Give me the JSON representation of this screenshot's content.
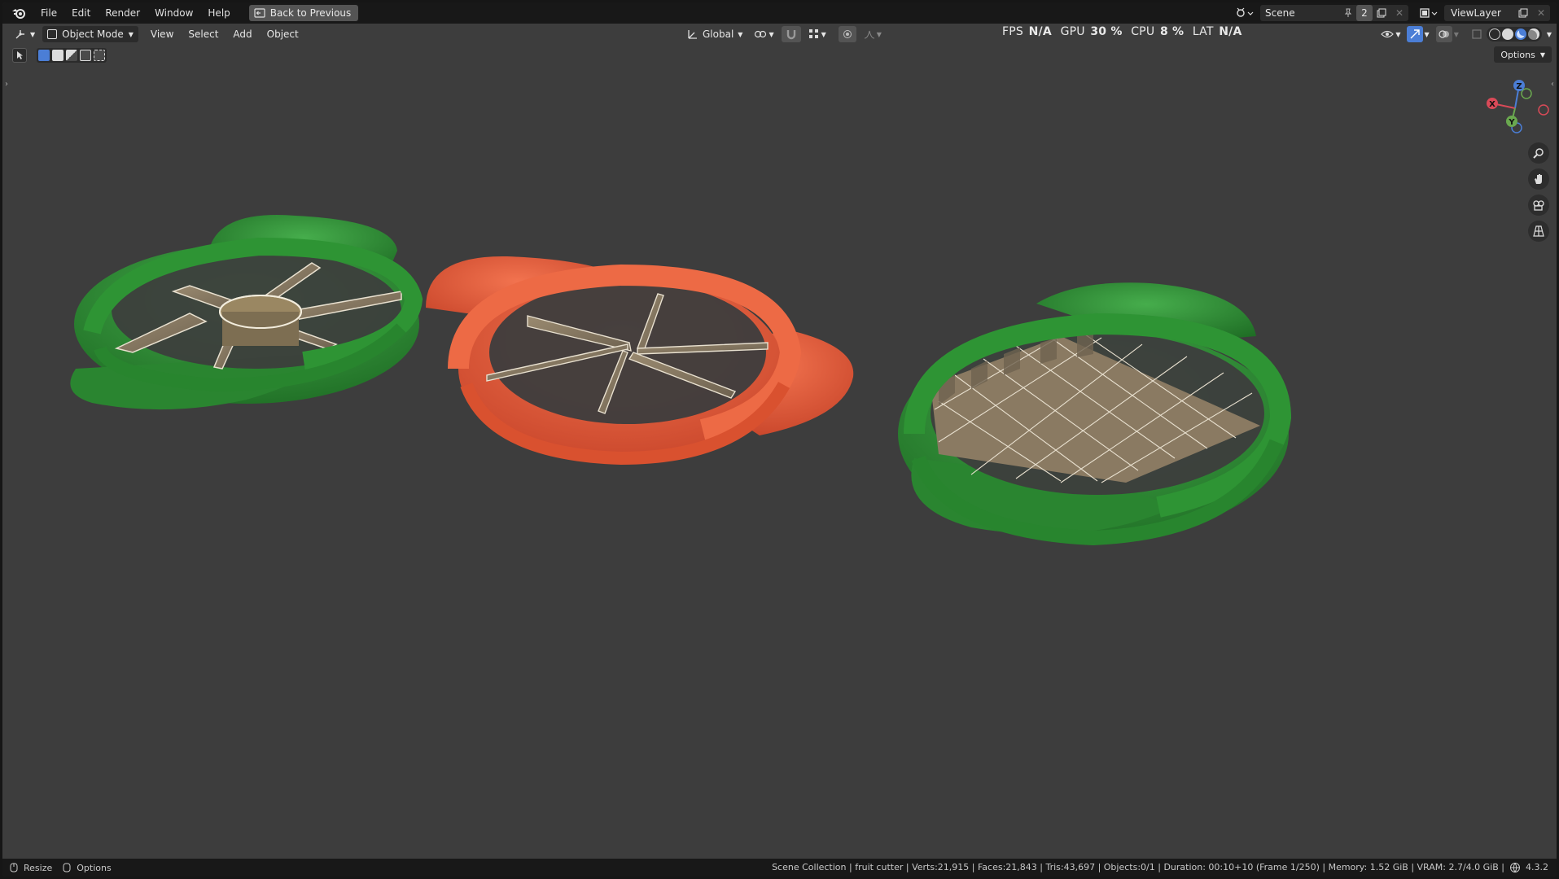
{
  "menu": {
    "items": [
      "File",
      "Edit",
      "Render",
      "Window",
      "Help"
    ],
    "back_label": "Back to Previous"
  },
  "topright": {
    "scene_name": "Scene",
    "scene_users": "2",
    "view_layer": "ViewLayer"
  },
  "header": {
    "mode": "Object Mode",
    "menus": [
      "View",
      "Select",
      "Add",
      "Object"
    ],
    "orientation": "Global",
    "options_label": "Options"
  },
  "perf": {
    "fps_label": "FPS",
    "fps_value": "N/A",
    "gpu_label": "GPU",
    "gpu_value": "30 %",
    "cpu_label": "CPU",
    "cpu_value": "8 %",
    "lat_label": "LAT",
    "lat_value": "N/A"
  },
  "gizmo": {
    "z": "Z",
    "x": "X",
    "y": "Y"
  },
  "status": {
    "resize_label": "Resize",
    "options_label": "Options",
    "stats": "Scene Collection | fruit cutter | Verts:21,915 | Faces:21,843 | Tris:43,697 | Objects:0/1 | Duration: 00:10+10 (Frame 1/250) | Memory: 1.52 GiB | VRAM: 2.7/4.0 GiB |",
    "version": "4.3.2"
  },
  "colors": {
    "green": "#2e8b34",
    "orange": "#e45a3a",
    "blade": "#8a7a62",
    "viewport_bg": "#3d3d3d"
  }
}
